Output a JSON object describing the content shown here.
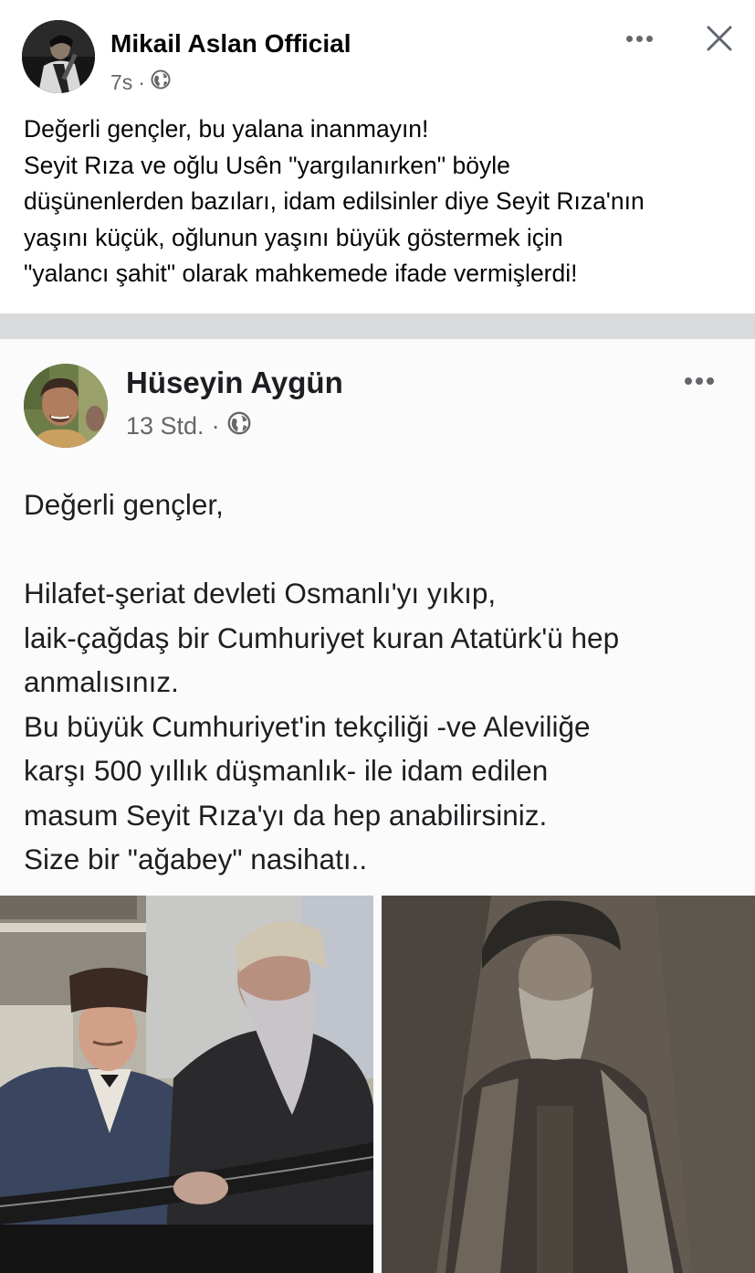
{
  "post": {
    "author": "Mikail Aslan Official",
    "time": "7s",
    "separator": "·",
    "lines": [
      "Değerli gençler, bu yalana inanmayın!",
      "Seyit Rıza ve oğlu Usên \"yargılanırken\" böyle",
      "düşünenlerden bazıları, idam edilsinler diye Seyit Rıza'nın",
      "yaşını küçük, oğlunun yaşını büyük göstermek için",
      "\"yalancı şahit\" olarak mahkemede ifade vermişlerdi!"
    ]
  },
  "shared_post": {
    "author": "Hüseyin Aygün",
    "time": "13 Std.",
    "separator": "·",
    "lines": [
      "Değerli gençler,",
      "",
      "Hilafet-şeriat devleti Osmanlı'yı yıkıp,",
      "laik-çağdaş bir Cumhuriyet kuran Atatürk'ü hep",
      "anmalısınız.",
      "Bu büyük Cumhuriyet'in tekçiliği -ve Aleviliğe",
      "karşı 500 yıllık düşmanlık- ile idam edilen",
      "masum Seyit Rıza'yı da hep anabilirsiniz.",
      "Size bir \"ağabey\" nasihatı.."
    ]
  },
  "icons": {
    "privacy": "globe-icon",
    "more": "more-options-icon",
    "close": "close-icon"
  },
  "colors": {
    "text": "#050505",
    "meta": "#65676b",
    "divider": "#d9dadc"
  }
}
